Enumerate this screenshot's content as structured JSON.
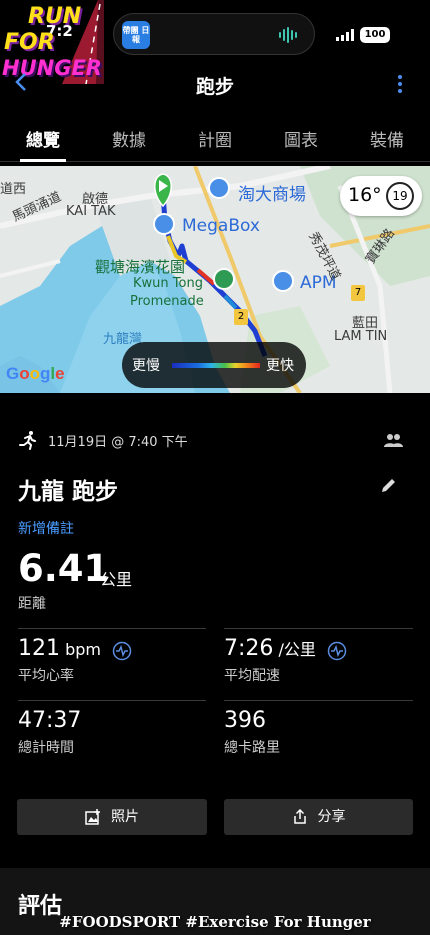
{
  "status": {
    "time": "7:2",
    "battery": "100",
    "island_app": "帶團 日報"
  },
  "logo": {
    "line1": "RUN",
    "line2": "FOR",
    "line3": "HUNGER"
  },
  "nav": {
    "title": "跑步"
  },
  "tabs": [
    {
      "label": "總覽",
      "active": true
    },
    {
      "label": "數據",
      "active": false
    },
    {
      "label": "計圈",
      "active": false
    },
    {
      "label": "圖表",
      "active": false
    },
    {
      "label": "裝備",
      "active": false
    }
  ],
  "map": {
    "labels": {
      "daoxi": "道西",
      "mating": "馬頭涌道",
      "qide_cn": "啟德",
      "qide_en": "KAI TAK",
      "taoda": "淘大商場",
      "megabox": "MegaBox",
      "garden_cn": "觀塘海濱花園",
      "garden_en1": "Kwun Tong",
      "garden_en2": "Promenade",
      "apm": "APM",
      "xiumao": "秀茂坪道",
      "baolin": "寶琳路",
      "lantian_cn": "藍田",
      "lantian_en": "LAM TIN",
      "bay": "九龍灣",
      "route2": "2",
      "route7": "7"
    },
    "weather": {
      "temp": "16°",
      "cond": "19"
    },
    "attribution": "Google",
    "legend": {
      "slow": "更慢",
      "fast": "更快"
    }
  },
  "activity": {
    "date": "11月19日 @ 7:40 下午",
    "title": "九龍 跑步",
    "add_note": "新增備註",
    "distance": {
      "value": "6.41",
      "unit": "公里",
      "label": "距離"
    },
    "heart_rate": {
      "value": "121",
      "unit": "bpm",
      "label": "平均心率"
    },
    "pace": {
      "value": "7:26",
      "unit": "/公里",
      "label": "平均配速"
    },
    "time": {
      "value": "47:37",
      "label": "總計時間"
    },
    "calories": {
      "value": "396",
      "label": "總卡路里"
    }
  },
  "buttons": {
    "photo": "照片",
    "share": "分享"
  },
  "section": {
    "evaluation": "評估"
  },
  "caption": "#FOODSPORT #Exercise For Hunger",
  "colors": {
    "accent": "#4a9bff",
    "background": "#000000",
    "button": "#2b2b2b"
  }
}
